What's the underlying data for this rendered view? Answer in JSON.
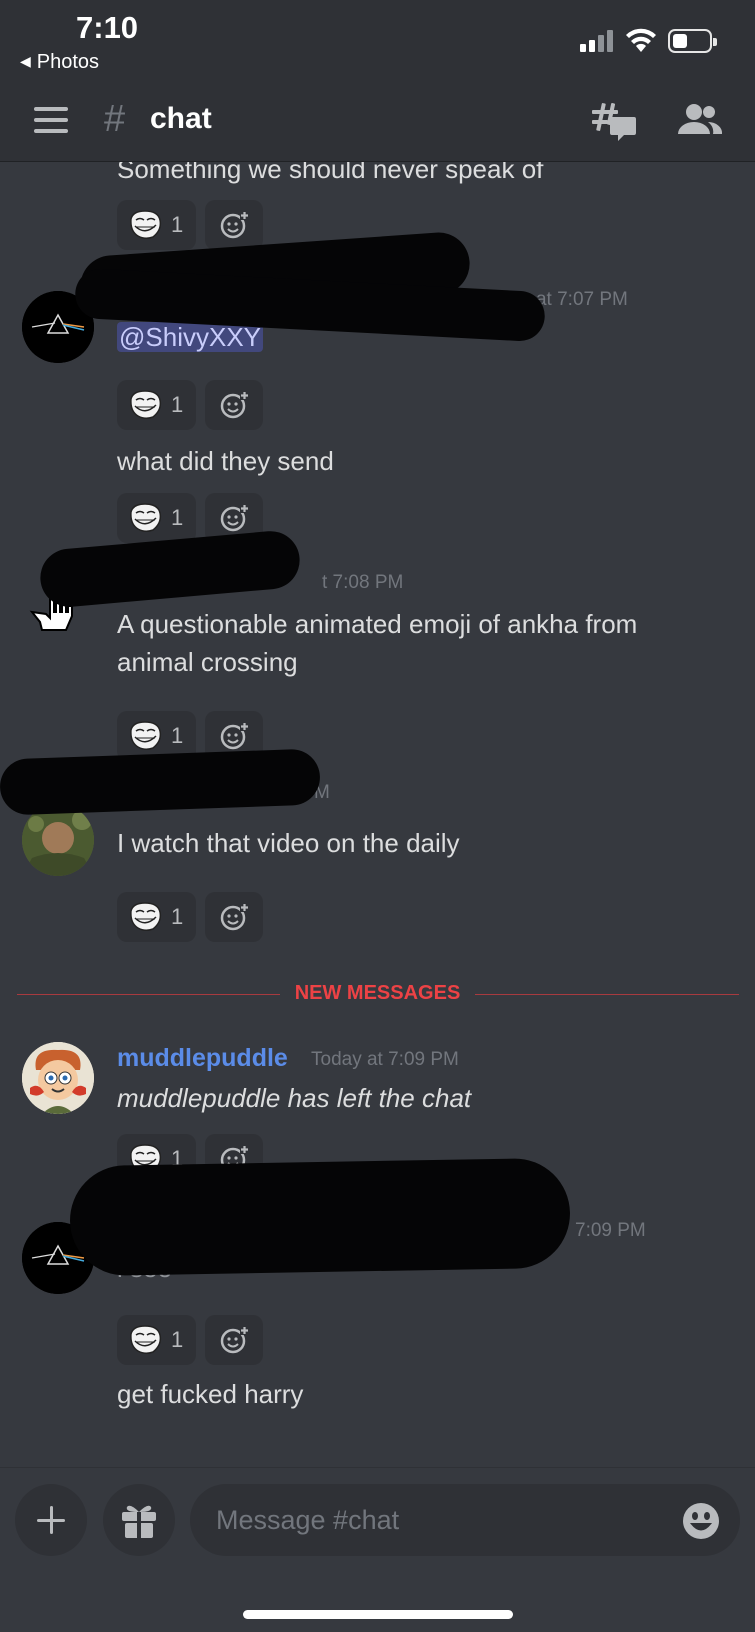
{
  "status_bar": {
    "time": "7:10",
    "back_label": "Photos",
    "back_icon": "left-triangle",
    "icons": [
      "cellular-signal-icon",
      "wifi-icon",
      "battery-icon"
    ]
  },
  "header": {
    "menu_icon": "hamburger-menu-icon",
    "channel_prefix": "#",
    "channel_name": "chat",
    "threads_icon": "threads-icon",
    "members_icon": "members-icon"
  },
  "messages": [
    {
      "kind": "continuation",
      "text": "Something we should never speak of",
      "reactions": [
        {
          "emoji": "trollface",
          "count": "1"
        }
      ]
    },
    {
      "kind": "group",
      "username_redacted": true,
      "timestamp": "Today at 7:07 PM",
      "avatar": "prism-avatar",
      "text": "@ShivyXXY",
      "mention": true,
      "reactions": [
        {
          "emoji": "trollface",
          "count": "1"
        }
      ]
    },
    {
      "kind": "continuation",
      "text": "what did they send",
      "reactions": [
        {
          "emoji": "trollface",
          "count": "1"
        }
      ]
    },
    {
      "kind": "group",
      "username_redacted": true,
      "timestamp": "t 7:08 PM",
      "avatar": "hand-cursor-avatar",
      "text_lines": [
        "A questionable animated emoji of ankha from",
        "animal crossing"
      ],
      "reactions": [
        {
          "emoji": "trollface",
          "count": "1"
        }
      ]
    },
    {
      "kind": "group",
      "username_redacted": true,
      "timestamp": "M",
      "avatar": "photo-avatar",
      "text": "I watch that video on the daily",
      "reactions": [
        {
          "emoji": "trollface",
          "count": "1"
        }
      ]
    },
    {
      "kind": "group",
      "username": "muddlepuddle",
      "timestamp": "Today at 7:09 PM",
      "avatar": "cartoon-avatar",
      "text": "muddlepuddle has left the chat",
      "reactions": [
        {
          "emoji": "trollface",
          "count": "1"
        }
      ]
    },
    {
      "kind": "group",
      "username_redacted": true,
      "timestamp": "7:09 PM",
      "avatar": "prism-avatar",
      "text": "i see",
      "reactions": [
        {
          "emoji": "trollface",
          "count": "1"
        }
      ]
    },
    {
      "kind": "continuation",
      "text": "get fucked harry"
    }
  ],
  "new_messages_divider": "NEW MESSAGES",
  "composer": {
    "placeholder": "Message #chat",
    "add_icon": "plus-icon",
    "gift_icon": "gift-icon",
    "emoji_icon": "smiley-icon"
  },
  "colors": {
    "background": "#36393f",
    "header": "#2f3136",
    "username": "#5b8ce8",
    "new_messages": "#ed4245"
  }
}
